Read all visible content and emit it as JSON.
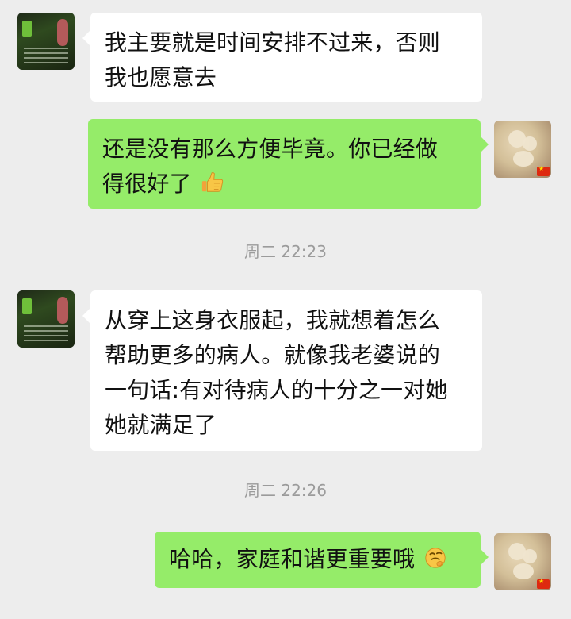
{
  "chat": {
    "messages": [
      {
        "side": "left",
        "lines": [
          "我主要就是时间安排不过来，否则",
          "我也愿意去"
        ]
      },
      {
        "side": "right",
        "lines": [
          "还是没有那么方便毕竟。你已经做",
          "得很好了"
        ],
        "emoji": "thumbs-up-icon"
      },
      {
        "side": "left",
        "lines": [
          "从穿上这身衣服起，我就想着怎么",
          "帮助更多的病人。就像我老婆说的",
          "一句话:有对待病人的十分之一对她",
          "她就满足了"
        ]
      },
      {
        "side": "right",
        "lines": [
          "哈哈，家庭和谐更重要哦"
        ],
        "emoji": "thinking-face-icon"
      }
    ],
    "timestamps": [
      "周二 22:23",
      "周二 22:26"
    ]
  },
  "colors": {
    "background": "#ededed",
    "bubble_left": "#ffffff",
    "bubble_right": "#95ec69",
    "timestamp": "#9b9b9b"
  }
}
